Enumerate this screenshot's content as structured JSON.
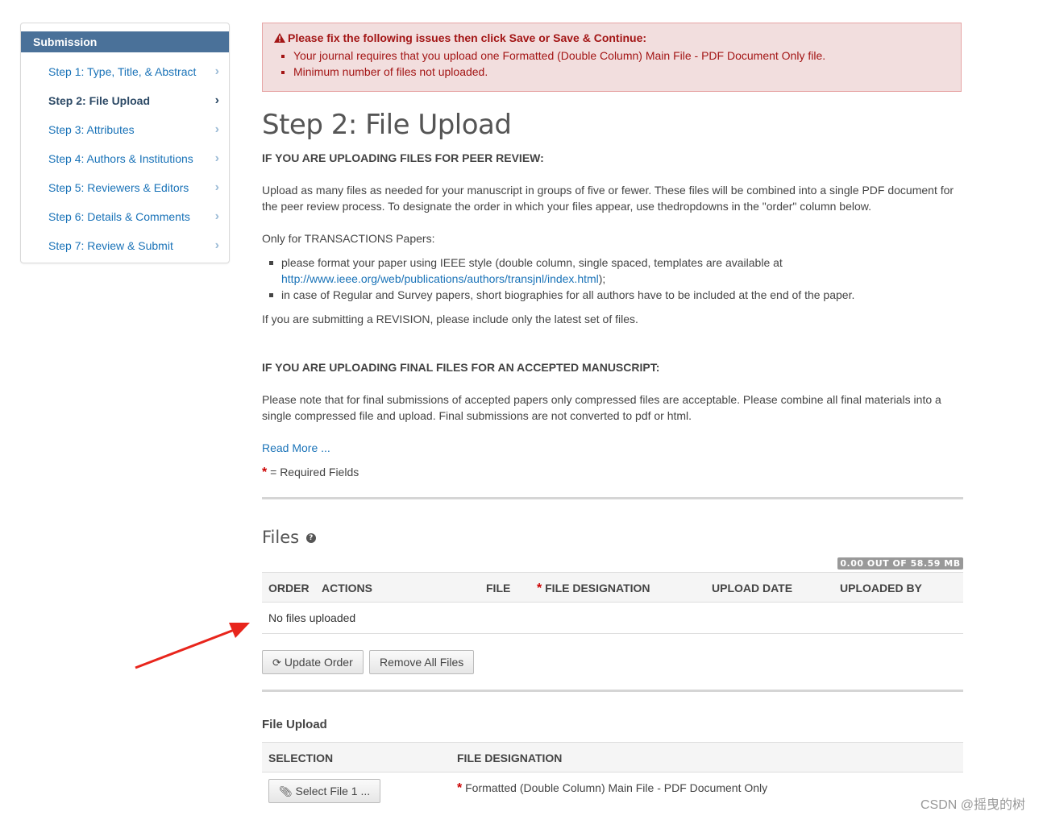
{
  "sidebar": {
    "title": "Submission",
    "items": [
      {
        "label": "Step 1: Type, Title, & Abstract",
        "active": false
      },
      {
        "label": "Step 2: File Upload",
        "active": true
      },
      {
        "label": "Step 3: Attributes",
        "active": false
      },
      {
        "label": "Step 4: Authors & Institutions",
        "active": false
      },
      {
        "label": "Step 5: Reviewers & Editors",
        "active": false
      },
      {
        "label": "Step 6: Details & Comments",
        "active": false
      },
      {
        "label": "Step 7: Review & Submit",
        "active": false
      }
    ]
  },
  "alert": {
    "title": "Please fix the following issues then click Save or Save & Continue:",
    "items": [
      "Your journal requires that you upload one Formatted (Double Column) Main File - PDF Document Only file.",
      "Minimum number of files not uploaded."
    ]
  },
  "page": {
    "title": "Step 2: File Upload",
    "peer_review_heading": "IF YOU ARE UPLOADING FILES FOR PEER REVIEW:",
    "peer_review_text_1": "Upload as many files as needed for your manuscript in groups of five or fewer. These files will be combined into a single PDF document for",
    "peer_review_text_2": "the peer review process. To designate the order in which your files appear, use thedropdowns in the \"order\" column below.",
    "transactions_intro": "Only for TRANSACTIONS Papers:",
    "bullet_1_line_1": "please format your paper using IEEE style (double column, single spaced, templates are available at",
    "bullet_1_link": "http://www.ieee.org/web/publications/authors/transjnl/index.html",
    "bullet_1_end": ");",
    "bullet_2": "in case of Regular and Survey papers, short biographies for all authors have to be included at the end of the paper.",
    "revision_note": "If you are submitting a REVISION, please include only the latest set of files.",
    "final_heading": "IF YOU ARE UPLOADING FINAL FILES FOR AN ACCEPTED MANUSCRIPT:",
    "final_text_1": "Please note that for final submissions of accepted papers only compressed files are acceptable. Please combine all final materials into a",
    "final_text_2": "single compressed file and upload. Final submissions are not converted to pdf or html.",
    "read_more": "Read More ...",
    "required_star": "*",
    "required_label": "= Required Fields"
  },
  "files": {
    "heading": "Files",
    "help_glyph": "?",
    "quota": "0.00 OUT OF 58.59 MB",
    "columns": {
      "order": "ORDER",
      "actions": "ACTIONS",
      "file": "FILE",
      "designation": "FILE DESIGNATION",
      "upload_date": "UPLOAD DATE",
      "uploaded_by": "UPLOADED BY"
    },
    "empty_message": "No files uploaded",
    "update_order_label": "Update Order",
    "remove_all_label": "Remove All Files"
  },
  "file_upload": {
    "heading": "File Upload",
    "col_selection": "SELECTION",
    "col_designation": "FILE DESIGNATION",
    "select_label": "Select File 1 ...",
    "designation_value": "Formatted (Double Column) Main File - PDF Document Only"
  },
  "watermark": "CSDN @摇曳的树",
  "colors": {
    "sidebar_header": "#4a7199",
    "link": "#1a73b8",
    "alert_bg": "#f2dede",
    "alert_text": "#a31515",
    "arrow": "#e8251c"
  },
  "icons": {
    "warning": "warning-triangle-icon",
    "chevron": "chevron-right-icon",
    "refresh": "refresh-icon",
    "paperclip": "paperclip-icon",
    "help": "question-circle-icon"
  }
}
